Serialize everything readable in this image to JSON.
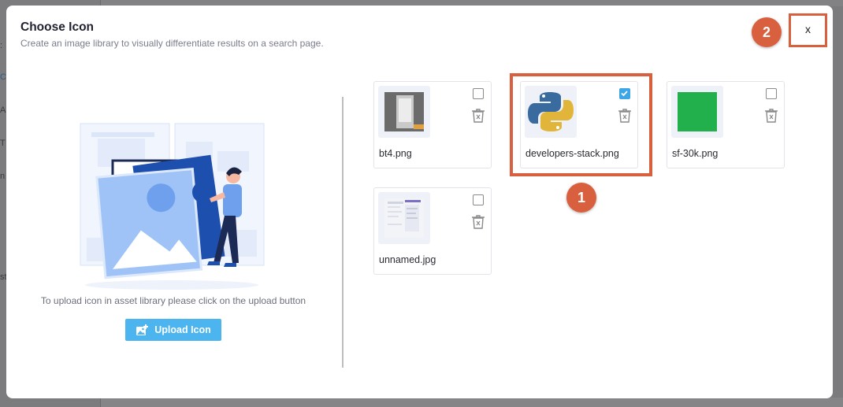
{
  "background": {
    "fragments": [
      ":",
      "C",
      "A",
      "T",
      "n",
      "st"
    ]
  },
  "modal": {
    "title": "Choose Icon",
    "subtitle": "Create an image library to visually differentiate results on a search page.",
    "close_label": "x"
  },
  "callouts": {
    "one": "1",
    "two": "2"
  },
  "upload": {
    "hint": "To upload icon in asset library please click on the upload button",
    "button_label": "Upload Icon"
  },
  "assets": [
    {
      "name": "bt4.png",
      "checked": false
    },
    {
      "name": "developers-stack.png",
      "checked": true
    },
    {
      "name": "sf-30k.png",
      "checked": false
    },
    {
      "name": "unnamed.jpg",
      "checked": false
    }
  ],
  "colors": {
    "accent": "#d9603f",
    "primary": "#4cb5f0",
    "checkbox_checked": "#3ea6e6",
    "sf_green": "#21b04b"
  }
}
